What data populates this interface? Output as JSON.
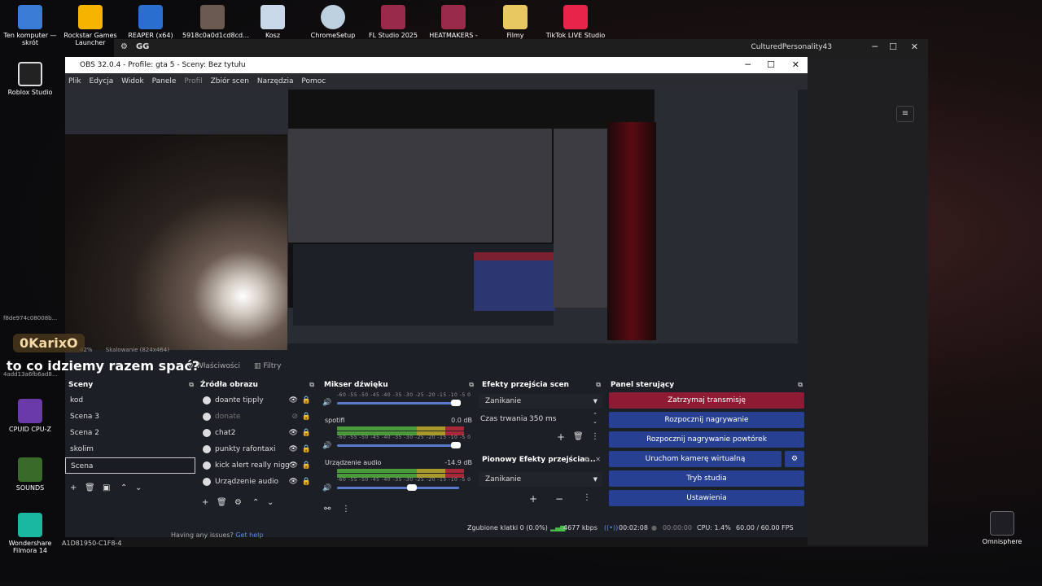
{
  "desktop_icons": [
    {
      "label": "Ten komputer — skrót",
      "icon": "computer-icon"
    },
    {
      "label": "Rockstar Games Launcher",
      "icon": "rockstar-icon"
    },
    {
      "label": "REAPER (x64)",
      "icon": "reaper-icon"
    },
    {
      "label": "5918c0a0d1cd8cd...",
      "icon": "image-file-icon"
    },
    {
      "label": "Kosz",
      "icon": "recycle-bin-icon"
    },
    {
      "label": "ChromeSetup",
      "icon": "chrome-setup-icon"
    },
    {
      "label": "FL Studio 2025",
      "icon": "winrar-icon"
    },
    {
      "label": "HEATMAKERS -",
      "icon": "winrar-icon"
    },
    {
      "label": "Filmy",
      "icon": "folder-icon"
    },
    {
      "label": "TikTok LIVE Studio",
      "icon": "tiktok-icon"
    },
    {
      "label": "Roblox Studio",
      "icon": "roblox-icon"
    },
    {
      "label": "CPUID CPU-Z",
      "icon": "cpuz-icon"
    },
    {
      "label": "SOUNDS",
      "icon": "sounds-icon"
    },
    {
      "label": "Wondershare Filmora 14",
      "icon": "filmora-icon"
    },
    {
      "label": "Omnisphere",
      "icon": "omnisphere-icon"
    }
  ],
  "background_app": {
    "title": "GG",
    "account": "CulturedPersonality43"
  },
  "obs": {
    "title": "OBS 32.0.4 - Profile: gta 5 - Sceny: Bez tytułu",
    "menu": [
      "Plik",
      "Edycja",
      "Widok",
      "Panele",
      "Profil",
      "Zbiór scen",
      "Narzędzia",
      "Pomoc"
    ],
    "preview_info": {
      "zoom": "42%",
      "scaling": "Skalowanie (824x464)"
    },
    "tabs": {
      "properties": "Właściwości",
      "filters": "Filtry"
    },
    "scenes": {
      "title": "Sceny",
      "items": [
        "kod",
        "Scena 3",
        "Scena 2",
        "skolim",
        "Scena"
      ],
      "selected_index": 4
    },
    "sources": {
      "title": "Źródła obrazu",
      "items": [
        {
          "name": "doante tipply",
          "visible": true
        },
        {
          "name": "donate",
          "visible": false
        },
        {
          "name": "chat2",
          "visible": true
        },
        {
          "name": "punkty rafontaxi",
          "visible": true
        },
        {
          "name": "kick alert really nigg",
          "visible": true
        },
        {
          "name": "Urządzenie audio",
          "visible": true
        }
      ]
    },
    "mixer": {
      "title": "Mikser dźwięku",
      "scale": "-60 -55 -50 -45 -40 -35 -30 -25 -20 -15 -10 -5 0",
      "channels": [
        {
          "name": "",
          "db": "",
          "volume": 1.0
        },
        {
          "name": "spotifi",
          "db": "0.0 dB",
          "volume": 1.0
        },
        {
          "name": "Urządzenie audio",
          "db": "-14.9 dB",
          "volume": 0.58
        }
      ]
    },
    "transitions": {
      "title": "Efekty przejścia scen",
      "selected": "Zanikanie",
      "duration_label": "Czas trwania",
      "duration_value": "350 ms",
      "vertical_title": "Pionowy Efekty przejścia ...",
      "vertical_selected": "Zanikanie"
    },
    "controls": {
      "title": "Panel sterujący",
      "buttons": [
        "Zatrzymaj transmisję",
        "Rozpocznij nagrywanie",
        "Rozpocznij nagrywanie powtórek",
        "Uruchom kamerę wirtualną",
        "Tryb studia",
        "Ustawienia"
      ]
    },
    "status": {
      "dropped": "Zgubione klatki 0 (0.0%)",
      "bitrate": "4677 kbps",
      "live_time": "00:02:08",
      "rec_time": "00:00:00",
      "cpu": "CPU: 1.4%",
      "fps": "60.00 / 60.00 FPS"
    }
  },
  "stream_overlay": {
    "username": "0KarixO",
    "message": "to co idziemy razem spać?"
  },
  "truncated_texts": {
    "top_id": "f8de974c08008b...",
    "side_id": "4add13a6fb6ad8...",
    "device_id": "A1D81950-C1F8-4"
  },
  "help": {
    "text": "Having any issues?",
    "link": "Get help"
  }
}
